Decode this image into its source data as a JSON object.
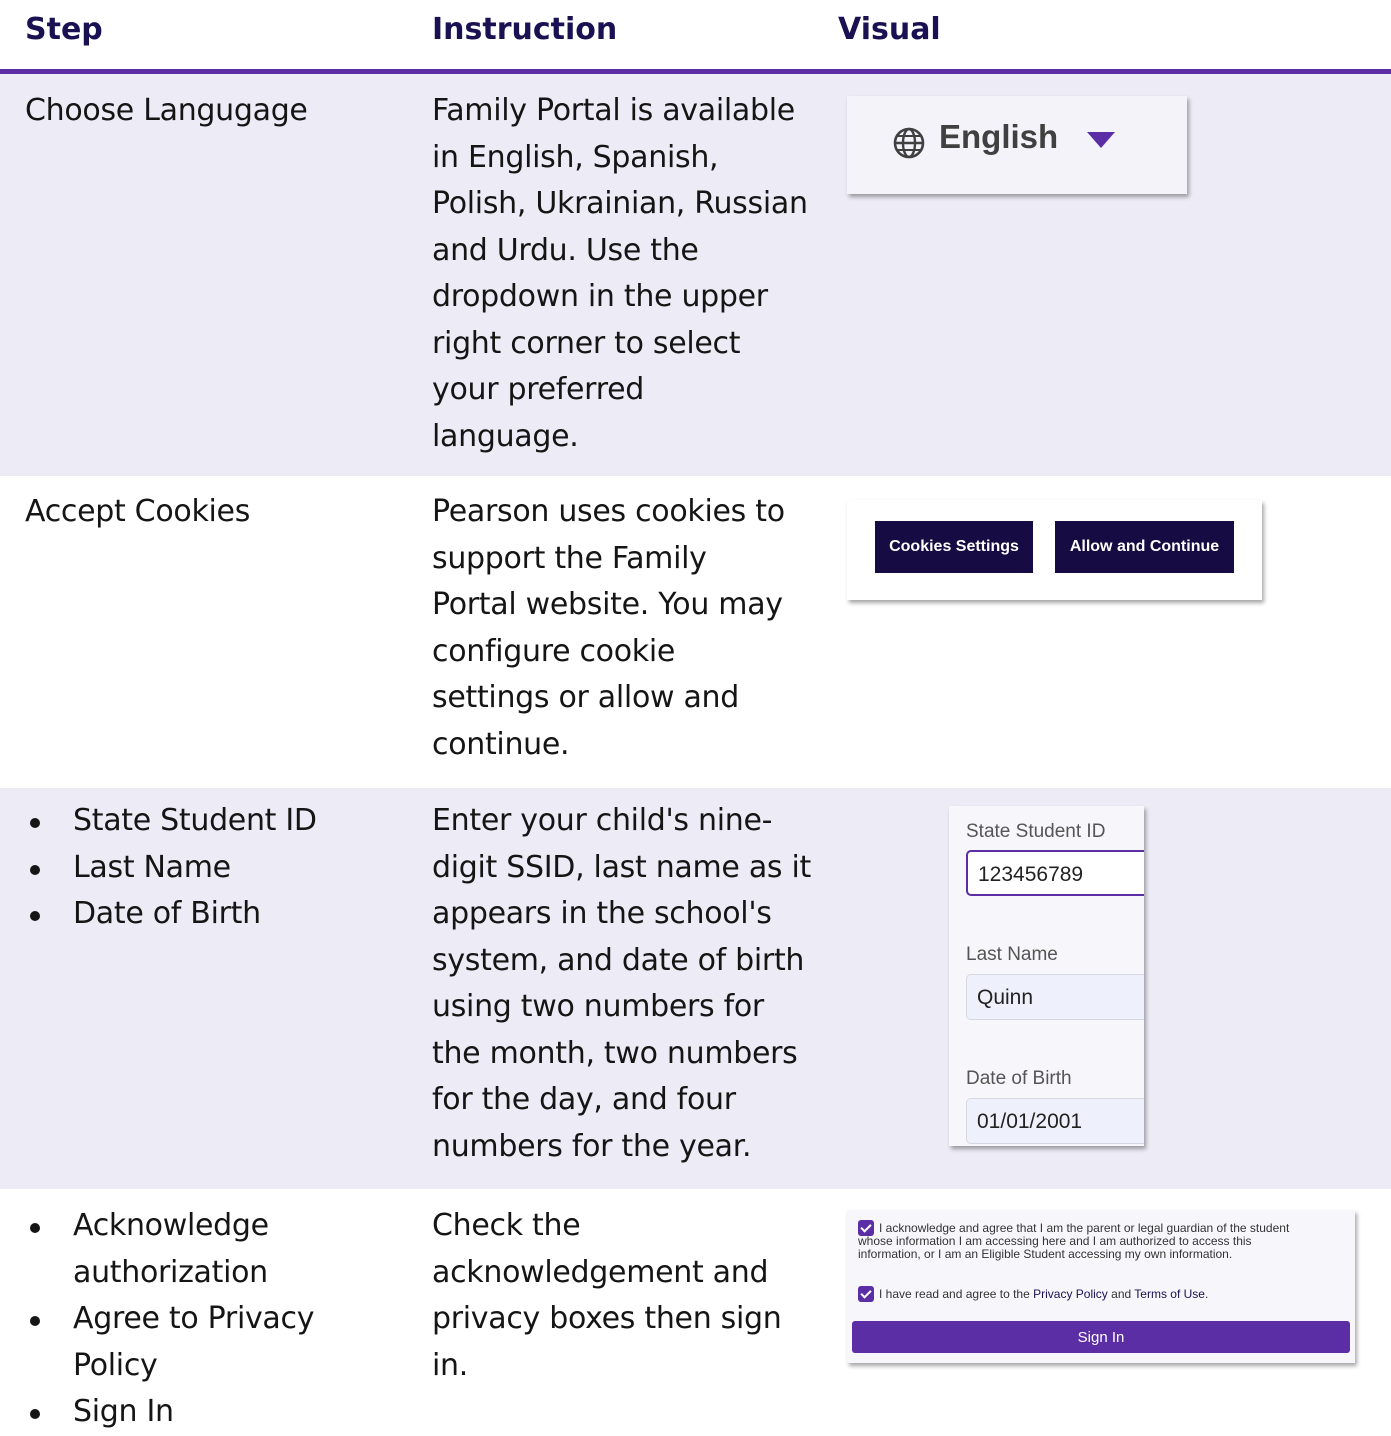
{
  "headers": {
    "step": "Step",
    "instruction": "Instruction",
    "visual": "Visual"
  },
  "rows": [
    {
      "step": "Choose Langugage",
      "instruction_lines": [
        "Family Portal is available",
        "in English, Spanish,",
        "Polish, Ukrainian, Russian",
        "and Urdu. Use the",
        "dropdown in the upper",
        "right corner to select",
        "your preferred",
        "language."
      ],
      "visual": {
        "language": "English",
        "icon": "globe-icon"
      }
    },
    {
      "step": "Accept Cookies",
      "instruction_lines": [
        "Pearson uses cookies to",
        "support the Family",
        "Portal website. You may",
        "configure cookie",
        "settings or allow and",
        "continue."
      ],
      "visual": {
        "cookies_settings": "Cookies Settings",
        "allow_continue": "Allow and Continue"
      }
    },
    {
      "steps": [
        "State Student ID",
        "Last Name",
        "Date of Birth"
      ],
      "instruction_lines": [
        "Enter your child's nine-",
        "digit SSID, last name as it",
        "appears in the school's",
        "system, and date of birth",
        "using two numbers for",
        "the month, two numbers",
        "for the day, and four",
        "numbers for the year."
      ],
      "visual": {
        "ssid_label": "State Student ID",
        "ssid_value": "123456789",
        "lastname_label": "Last Name",
        "lastname_value": "Quinn",
        "dob_label": "Date of Birth",
        "dob_value": "01/01/2001"
      }
    },
    {
      "step_lines": [
        "Acknowledge",
        "authorization",
        "Agree to Privacy",
        "Policy",
        "Sign In"
      ],
      "instruction_lines": [
        "Check the",
        "acknowledgement and",
        "privacy boxes then sign",
        "in."
      ],
      "visual": {
        "ack_lines": [
          "I acknowledge and agree that I am the parent or legal guardian of the student",
          "whose information I am accessing here and I am authorized to access this",
          "information, or I am an Eligible Student accessing my own information."
        ],
        "privacy_prefix": "I have read and agree to the ",
        "privacy_link": "Privacy Policy",
        "privacy_and": " and ",
        "terms_link": "Terms of Use",
        "privacy_suffix": ".",
        "sign_in": "Sign In"
      }
    }
  ],
  "colors": {
    "accent": "#5b2ea6",
    "header_text": "#1a1153",
    "row_shade": "#edebf5",
    "dark_button": "#160b42"
  }
}
